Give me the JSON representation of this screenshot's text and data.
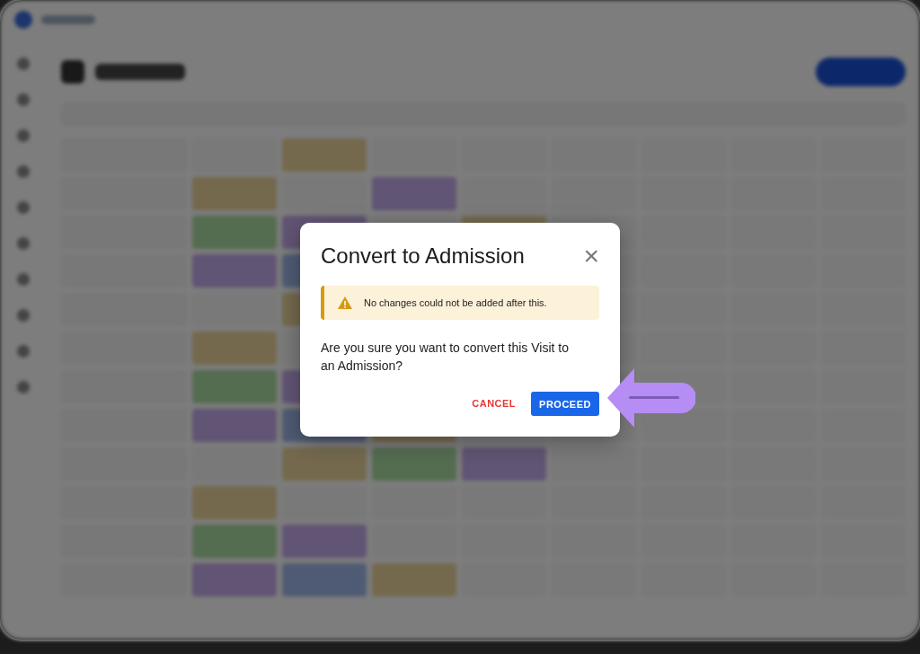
{
  "dialog": {
    "title": "Convert to Admission",
    "close_label": "×",
    "warning": {
      "text": "No changes could not be added after this."
    },
    "message": "Are you sure you want to convert this Visit to an Admission?",
    "buttons": [
      {
        "label": "CANCEL",
        "kind": "text"
      },
      {
        "label": "PROCEED",
        "kind": "primary"
      }
    ]
  }
}
